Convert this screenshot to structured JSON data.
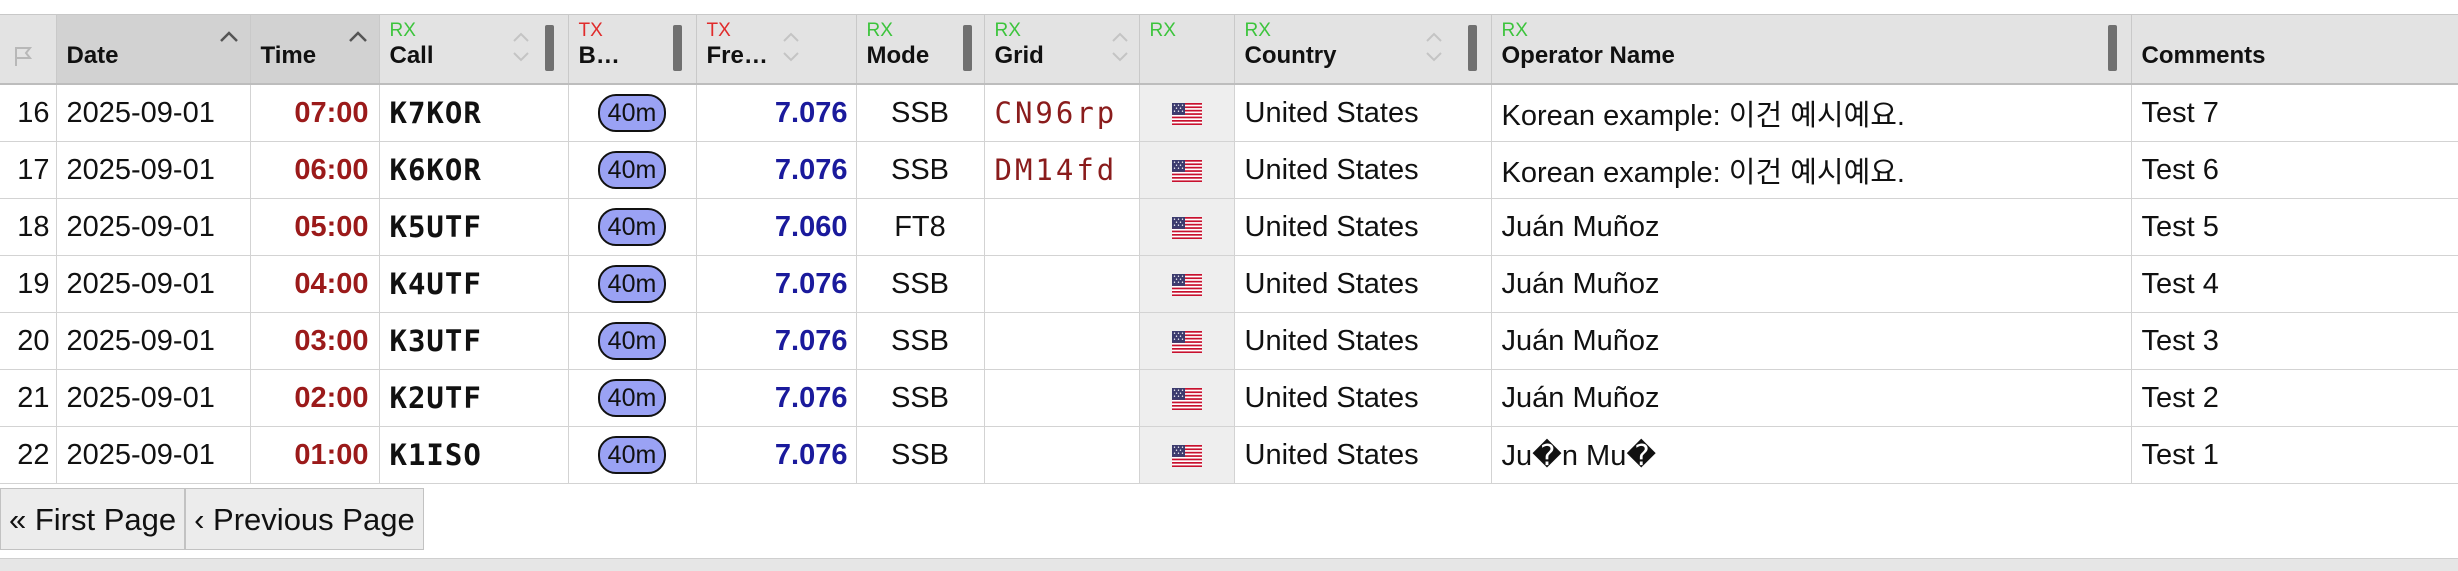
{
  "columns": {
    "date": "Date",
    "time": "Time",
    "call": "Call",
    "band": "B…",
    "freq": "Fre…",
    "mode": "Mode",
    "grid": "Grid",
    "country": "Country",
    "operator": "Operator Name",
    "comments": "Comments"
  },
  "direction": {
    "rx": "RX",
    "tx": "TX"
  },
  "rows": [
    {
      "num": "16",
      "date": "2025-09-01",
      "time": "07:00",
      "call": "K7KOR",
      "band": "40m",
      "freq": "7.076",
      "mode": "SSB",
      "grid": "CN96rp",
      "flag": "us-flag-icon",
      "country": "United States",
      "operator": "Korean example: 이건 예시예요.",
      "comments": "Test 7"
    },
    {
      "num": "17",
      "date": "2025-09-01",
      "time": "06:00",
      "call": "K6KOR",
      "band": "40m",
      "freq": "7.076",
      "mode": "SSB",
      "grid": "DM14fd",
      "flag": "us-flag-icon",
      "country": "United States",
      "operator": "Korean example: 이건 예시예요.",
      "comments": "Test 6"
    },
    {
      "num": "18",
      "date": "2025-09-01",
      "time": "05:00",
      "call": "K5UTF",
      "band": "40m",
      "freq": "7.060",
      "mode": "FT8",
      "grid": "",
      "flag": "us-flag-icon",
      "country": "United States",
      "operator": "Juán Muñoz",
      "comments": "Test 5"
    },
    {
      "num": "19",
      "date": "2025-09-01",
      "time": "04:00",
      "call": "K4UTF",
      "band": "40m",
      "freq": "7.076",
      "mode": "SSB",
      "grid": "",
      "flag": "us-flag-icon",
      "country": "United States",
      "operator": "Juán Muñoz",
      "comments": "Test 4"
    },
    {
      "num": "20",
      "date": "2025-09-01",
      "time": "03:00",
      "call": "K3UTF",
      "band": "40m",
      "freq": "7.076",
      "mode": "SSB",
      "grid": "",
      "flag": "us-flag-icon",
      "country": "United States",
      "operator": "Juán Muñoz",
      "comments": "Test 3"
    },
    {
      "num": "21",
      "date": "2025-09-01",
      "time": "02:00",
      "call": "K2UTF",
      "band": "40m",
      "freq": "7.076",
      "mode": "SSB",
      "grid": "",
      "flag": "us-flag-icon",
      "country": "United States",
      "operator": "Juán Muñoz",
      "comments": "Test 2"
    },
    {
      "num": "22",
      "date": "2025-09-01",
      "time": "01:00",
      "call": "K1ISO",
      "band": "40m",
      "freq": "7.076",
      "mode": "SSB",
      "grid": "",
      "flag": "us-flag-icon",
      "country": "United States",
      "operator": "Ju�n Mu�",
      "comments": "Test 1"
    }
  ],
  "pager": {
    "first": "« First Page",
    "previous": "‹ Previous Page"
  },
  "colors": {
    "rx": "#3cc43c",
    "tx": "#e02b2b",
    "time": "#9b1a1a",
    "freq": "#1a1a9c",
    "grid": "#8a1c1c",
    "band_pill": "#9aa2f4"
  }
}
